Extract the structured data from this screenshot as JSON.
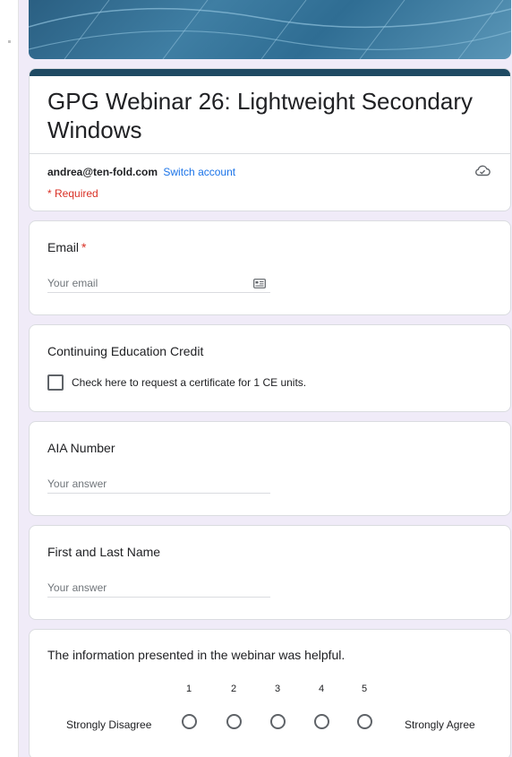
{
  "form": {
    "title": "GPG Webinar 26: Lightweight Secondary Windows",
    "account_email": "andrea@ten-fold.com",
    "switch_account_label": "Switch account",
    "required_note": "* Required"
  },
  "questions": {
    "email": {
      "label": "Email",
      "required_mark": "*",
      "placeholder": "Your email"
    },
    "ce_credit": {
      "label": "Continuing Education Credit",
      "checkbox_label": "Check here to request a certificate for 1 CE units."
    },
    "aia_number": {
      "label": "AIA Number",
      "placeholder": "Your answer"
    },
    "name": {
      "label": "First and Last Name",
      "placeholder": "Your answer"
    },
    "rating": {
      "label": "The information presented in the webinar was helpful.",
      "scale": [
        "1",
        "2",
        "3",
        "4",
        "5"
      ],
      "low_label": "Strongly Disagree",
      "high_label": "Strongly Agree"
    }
  },
  "icons": {
    "cloud": "cloud-check-icon",
    "contact": "contact-card-icon"
  },
  "colors": {
    "theme_bar": "#1f4a63",
    "required": "#d93025",
    "link": "#1a73e8",
    "background": "#f0ebf8"
  }
}
